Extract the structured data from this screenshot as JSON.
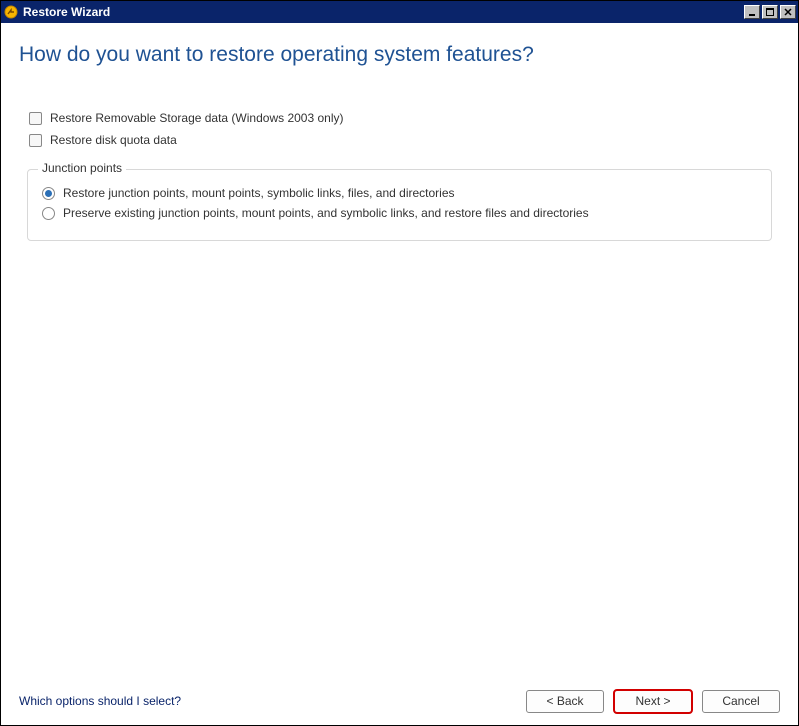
{
  "window": {
    "title": "Restore Wizard"
  },
  "heading": "How do you want to restore operating system features?",
  "checkboxes": [
    {
      "label": "Restore Removable Storage data (Windows 2003 only)",
      "checked": false
    },
    {
      "label": "Restore disk quota data",
      "checked": false
    }
  ],
  "junction": {
    "legend": "Junction points",
    "options": [
      {
        "label": "Restore junction points, mount points, symbolic links, files, and directories",
        "selected": true
      },
      {
        "label": "Preserve existing junction points, mount points, and symbolic links, and restore files and directories",
        "selected": false
      }
    ]
  },
  "footer": {
    "help_link": "Which options should I select?",
    "back": "< Back",
    "next": "Next >",
    "cancel": "Cancel"
  }
}
